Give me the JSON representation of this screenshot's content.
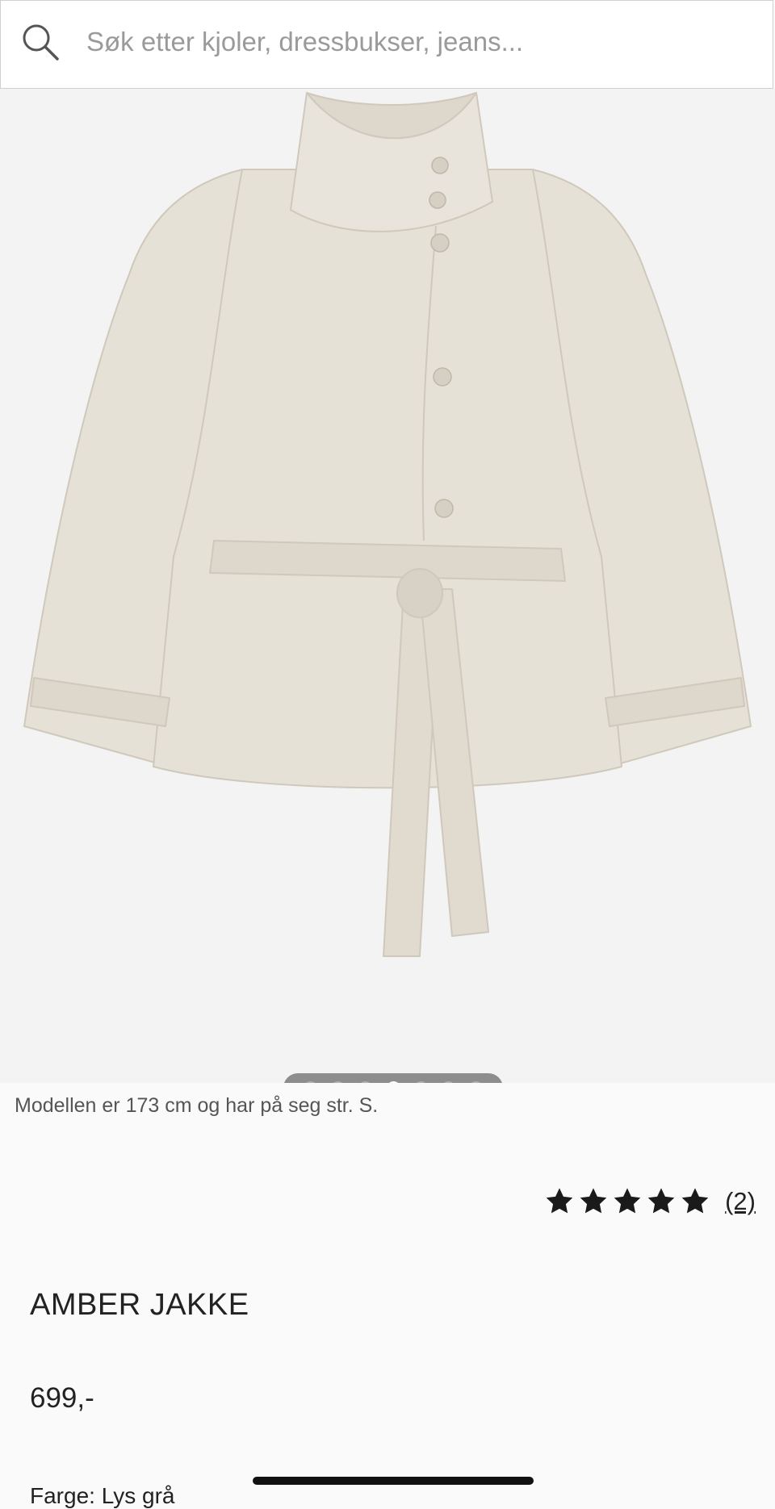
{
  "search": {
    "placeholder": "Søk etter kjoler, dressbukser, jeans..."
  },
  "gallery": {
    "image_count": 7,
    "active_index": 3,
    "jacket_color": "#e4dfd5"
  },
  "product": {
    "model_info": "Modellen er 173 cm og har på seg str. S.",
    "rating_stars": 5,
    "review_count": "(2)",
    "title": "AMBER JAKKE",
    "price": "699,-",
    "color_label": "Farge: Lys grå"
  },
  "icons": {
    "search": "search-icon",
    "star": "star-icon"
  }
}
